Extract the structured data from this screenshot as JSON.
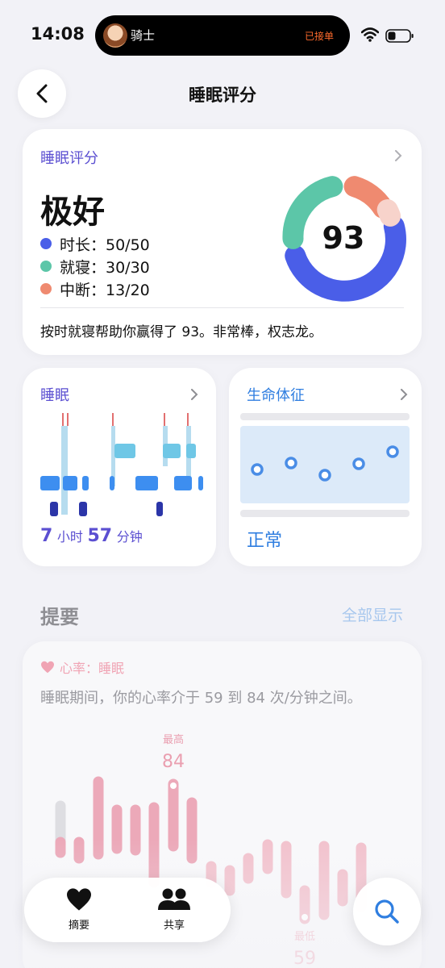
{
  "status_bar": {
    "time": "14:08",
    "island_title": "骑士",
    "island_status": "已接单"
  },
  "nav": {
    "title": "睡眠评分"
  },
  "score_card": {
    "title": "睡眠评分",
    "verdict": "极好",
    "score": "93",
    "legend": [
      {
        "label": "时长：50/50",
        "color": "#4a5ee8"
      },
      {
        "label": "就寝：30/30",
        "color": "#5cc6a8"
      },
      {
        "label": "中断：13/20",
        "color": "#ef8a70"
      }
    ],
    "note": "按时就寝帮助你赢得了 93。非常棒，权志龙。"
  },
  "sleep_card": {
    "title": "睡眠",
    "hours": "7",
    "hours_unit": "小时",
    "minutes": "57",
    "minutes_unit": "分钟"
  },
  "vitals_card": {
    "title": "生命体征",
    "status": "正常"
  },
  "summary": {
    "title": "提要",
    "show_all": "全部显示"
  },
  "hr_card": {
    "label": "心率：睡眠",
    "text": "睡眠期间，你的心率介于 59 到 84 次/分钟之间。",
    "max_label": "最高",
    "max_value": "84",
    "min_label": "最低",
    "min_value": "59"
  },
  "tab_bar": {
    "summary_label": "摘要",
    "share_label": "共享"
  },
  "colors": {
    "accent_purple": "#5b4fd1",
    "accent_blue": "#2f7ee0",
    "duration": "#4a5ee8",
    "bedtime": "#5cc6a8",
    "interruption": "#ef8a70",
    "heart": "#f0a4b4"
  }
}
